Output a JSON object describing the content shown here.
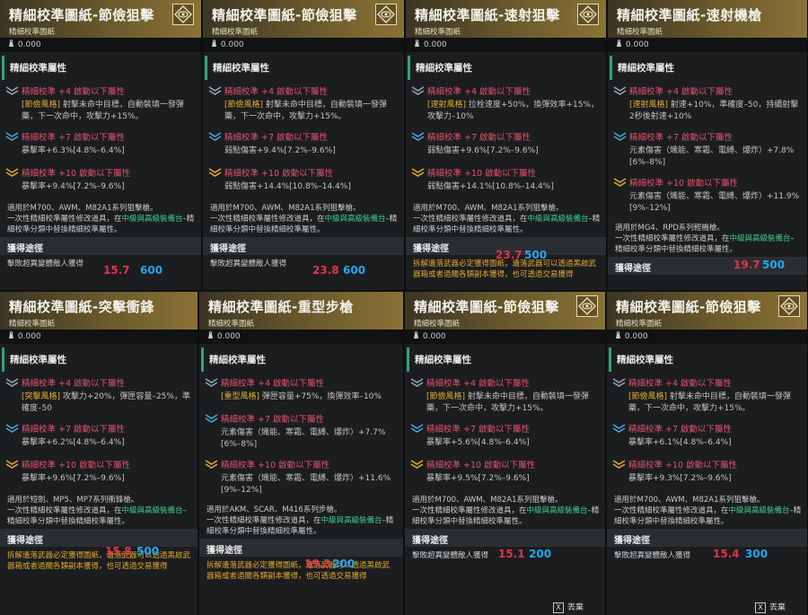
{
  "colors": {
    "accent_green": "#2fa676",
    "red": "#e2526f",
    "orange": "#e0b032",
    "blue_number": "#23a6f0",
    "red_number": "#e2344a",
    "header_gold": "#8a7236"
  },
  "subtitle": "精細校準圖紙",
  "weight": "0.000",
  "section": "精細校準屬性",
  "acquire": "獲得途徑",
  "discard_label": "丟棄",
  "discard_key": "X",
  "cards": [
    {
      "title": "精細校準圖紙-節儉狙擊",
      "tiers": [
        {
          "head": "精細校準 +4 啟動以下屬性",
          "tag": "[節儉風格]",
          "body": " 射擊未命中目標，自動裝填一發彈藥，下一次命中，攻擊力+15%。"
        },
        {
          "head": "精細校準 +7 啟動以下屬性",
          "tag": "",
          "body": "暴擊率+6.3%[4.8%–6.4%]"
        },
        {
          "head": "精細校準 +10 啟動以下屬性",
          "tag": "",
          "body": "暴擊率+9.4%[7.2%–9.6%]"
        }
      ],
      "applies": "適用於M700、AWM、M82A1系列狙擊槍。",
      "note_pre": "一次性精細校準屬性修改道具，在",
      "note_hl": "中級與高級裝備台",
      "note_post": "–精細校準分類中替換精細校準屬性。",
      "drop": "擊敗超異變體敵人獲得",
      "drop2": "",
      "red": "15.7",
      "blue": "600"
    },
    {
      "title": "精細校準圖紙-節儉狙擊",
      "tiers": [
        {
          "head": "精細校準 +4 啟動以下屬性",
          "tag": "[節儉風格]",
          "body": " 射擊未命中目標，自動裝填一發彈藥，下一次命中，攻擊力+15%。"
        },
        {
          "head": "精細校準 +7 啟動以下屬性",
          "tag": "",
          "body": "弱點傷害+9.4%[7.2%–9.6%]"
        },
        {
          "head": "精細校準 +10 啟動以下屬性",
          "tag": "",
          "body": "弱點傷害+14.4%[10.8%–14.4%]"
        }
      ],
      "applies": "適用於M700、AWM、M82A1系列狙擊槍。",
      "note_pre": "一次性精細校準屬性修改道具，在",
      "note_hl": "中級與高級裝備台",
      "note_post": "–精細校準分類中替換精細校準屬性。",
      "drop": "擊敗超異變體敵人獲得",
      "drop2": "",
      "red": "23.8",
      "blue": "600"
    },
    {
      "title": "精細校準圖紙-速射狙擊",
      "tiers": [
        {
          "head": "精細校準 +4 啟動以下屬性",
          "tag": "[速射風格]",
          "body": " 拉栓速度+50%，換彈效率+15%，攻擊力–10%"
        },
        {
          "head": "精細校準 +7 啟動以下屬性",
          "tag": "",
          "body": "弱點傷害+9.6%[7.2%–9.6%]"
        },
        {
          "head": "精細校準 +10 啟動以下屬性",
          "tag": "",
          "body": "弱點傷害+14.1%[10.8%–14.4%]"
        }
      ],
      "applies": "適用於M700、AWM、M82A1系列狙擊槍。",
      "note_pre": "一次性精細校準屬性修改道具，在",
      "note_hl": "中級與高級裝備台",
      "note_post": "–精細校準分類中替換精細校準屬性。",
      "drop": "拆解遺落武器必定獲得圖紙，遺落武器可以透過黑啟武器箱或者過關各類副本獲得，也可透過交易獲得",
      "drop2": "",
      "red": "23.7",
      "blue": "500"
    },
    {
      "title": "精細校準圖紙-速射機槍",
      "tiers": [
        {
          "head": "精細校準 +4 啟動以下屬性",
          "tag": "[速射風格]",
          "body": " 射速+10%，準確度–50，持續射擊2秒後射速+10%"
        },
        {
          "head": "精細校準 +7 啟動以下屬性",
          "tag": "",
          "body": "元素傷害（熾能、寒霜、電縛、爆炸）+7.8%[6%–8%]"
        },
        {
          "head": "精細校準 +10 啟動以下屬性",
          "tag": "",
          "body": "元素傷害（熾能、寒霜、電縛、爆炸）+11.9%[9%–12%]"
        }
      ],
      "applies": "適用於MG4、RPD系列輕機槍。",
      "note_pre": "一次性精細校準屬性修改道具，在",
      "note_hl": "中級與高級裝備台",
      "note_post": "–精細校準分類中替換精細校準屬性。",
      "drop": "",
      "drop2": "",
      "red": "19.7",
      "blue": "500"
    },
    {
      "title": "精細校準圖紙-突擊衝鋒",
      "tiers": [
        {
          "head": "精細校準 +4 啟動以下屬性",
          "tag": "[突擊風格]",
          "body": " 攻擊力+20%，彈匣容量–25%，準確度–50"
        },
        {
          "head": "精細校準 +7 啟動以下屬性",
          "tag": "",
          "body": "暴擊率+6.2%[4.8%–6.4%]"
        },
        {
          "head": "精細校準 +10 啟動以下屬性",
          "tag": "",
          "body": "暴擊率+9.6%[7.2%–9.6%]"
        }
      ],
      "applies": "適用於短劍、MP5、MP7系列衝鋒槍。",
      "note_pre": "一次性精細校準屬性修改道具，在",
      "note_hl": "中級與高級裝備台",
      "note_post": "–精細校準分類中替換精細校準屬性。",
      "drop": "拆解遺落武器必定獲得圖紙，遺落武器可以透過黑啟武器箱或者過關各類副本獲得，也可透過交易獲得",
      "drop2": "",
      "red": "15.8",
      "blue": "500"
    },
    {
      "title": "精細校準圖紙-重型步槍",
      "tiers": [
        {
          "head": "精細校準 +4 啟動以下屬性",
          "tag": "[重型風格]",
          "body": " 彈匣容量+75%，換彈效率–10%"
        },
        {
          "head": "精細校準 +7 啟動以下屬性",
          "tag": "",
          "body": "元素傷害（熾能、寒霜、電縛、爆炸）+7.7%[6%–8%]"
        },
        {
          "head": "精細校準 +10 啟動以下屬性",
          "tag": "",
          "body": "元素傷害（熾能、寒霜、電縛、爆炸）+11.6%[9%–12%]"
        }
      ],
      "applies": "適用於AKM、SCAR、M416系列步槍。",
      "note_pre": "一次性精細校準屬性修改道具，在",
      "note_hl": "中級與高級裝備台",
      "note_post": "–精細校準分類中替換精細校準屬性。",
      "drop": "拆解遺落武器必定獲得圖紙，遺落武器可以透過黑啟武器箱或者過關各類副本獲得，也可透過交易獲得",
      "drop2": "",
      "red": "19.3",
      "blue": "200"
    },
    {
      "title": "精細校準圖紙-節儉狙擊",
      "tiers": [
        {
          "head": "精細校準 +4 啟動以下屬性",
          "tag": "[節儉風格]",
          "body": " 射擊未命中目標，自動裝填一發彈藥，下一次命中，攻擊力+15%。"
        },
        {
          "head": "精細校準 +7 啟動以下屬性",
          "tag": "",
          "body": "暴擊率+5.6%[4.8%–6.4%]"
        },
        {
          "head": "精細校準 +10 啟動以下屬性",
          "tag": "",
          "body": "暴擊率+9.5%[7.2%–9.6%]"
        }
      ],
      "applies": "適用於M700、AWM、M82A1系列狙擊槍。",
      "note_pre": "一次性精細校準屬性修改道具，在",
      "note_hl": "中級與高級裝備台",
      "note_post": "–精細校準分類中替換精細校準屬性。",
      "drop": "擊敗超異變體敵人獲得",
      "drop2": "",
      "red": "15.1",
      "blue": "200"
    },
    {
      "title": "精細校準圖紙-節儉狙擊",
      "tiers": [
        {
          "head": "精細校準 +4 啟動以下屬性",
          "tag": "[節儉風格]",
          "body": " 射擊未命中目標，自動裝填一發彈藥，下一次命中，攻擊力+15%。"
        },
        {
          "head": "精細校準 +7 啟動以下屬性",
          "tag": "",
          "body": "暴擊率+6.1%[4.8%–6.4%]"
        },
        {
          "head": "精細校準 +10 啟動以下屬性",
          "tag": "",
          "body": "暴擊率+9.3%[7.2%–9.6%]"
        }
      ],
      "applies": "適用於M700、AWM、M82A1系列狙擊槍。",
      "note_pre": "一次性精細校準屬性修改道具，在",
      "note_hl": "中級與高級裝備台",
      "note_post": "–精細校準分類中替換精細校準屬性。",
      "drop": "擊敗超異變體敵人獲得",
      "drop2": "",
      "red": "15.4",
      "blue": "300"
    }
  ]
}
